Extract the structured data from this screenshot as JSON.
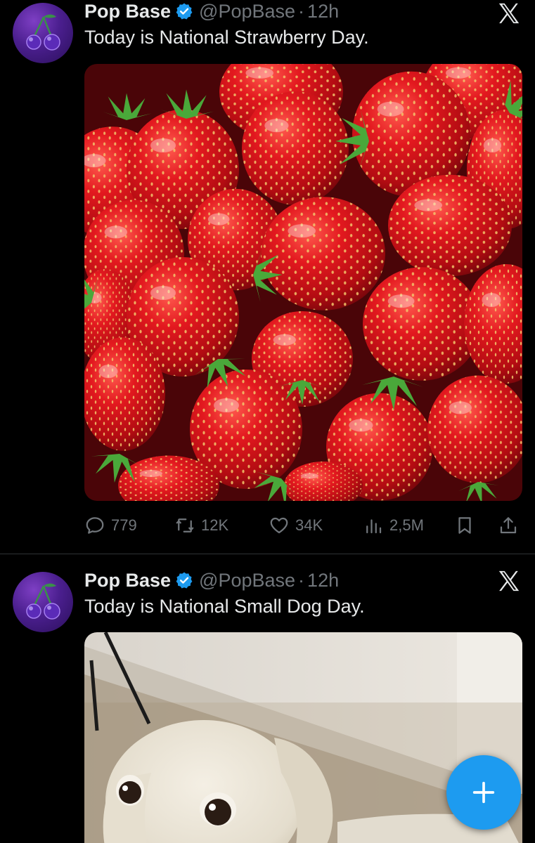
{
  "tweets": [
    {
      "name": "Pop Base",
      "handle": "@PopBase",
      "separator": "·",
      "time": "12h",
      "text": "Today is National Strawberry Day.",
      "media": "strawberries-photo",
      "actions": {
        "replies": "779",
        "reposts": "12K",
        "likes": "34K",
        "views": "2,5M"
      }
    },
    {
      "name": "Pop Base",
      "handle": "@PopBase",
      "separator": "·",
      "time": "12h",
      "text": "Today is National Small Dog Day.",
      "media": "small-dog-photo"
    }
  ],
  "colors": {
    "background": "#000000",
    "text_primary": "#e7e9ea",
    "text_secondary": "#71767b",
    "verified": "#1d9bf0",
    "fab": "#1d9bf0",
    "divider": "#2f3336"
  },
  "icons": [
    "verified-badge-icon",
    "x-logo-icon",
    "reply-icon",
    "repost-icon",
    "like-icon",
    "views-icon",
    "bookmark-icon",
    "share-icon",
    "compose-plus-icon"
  ]
}
